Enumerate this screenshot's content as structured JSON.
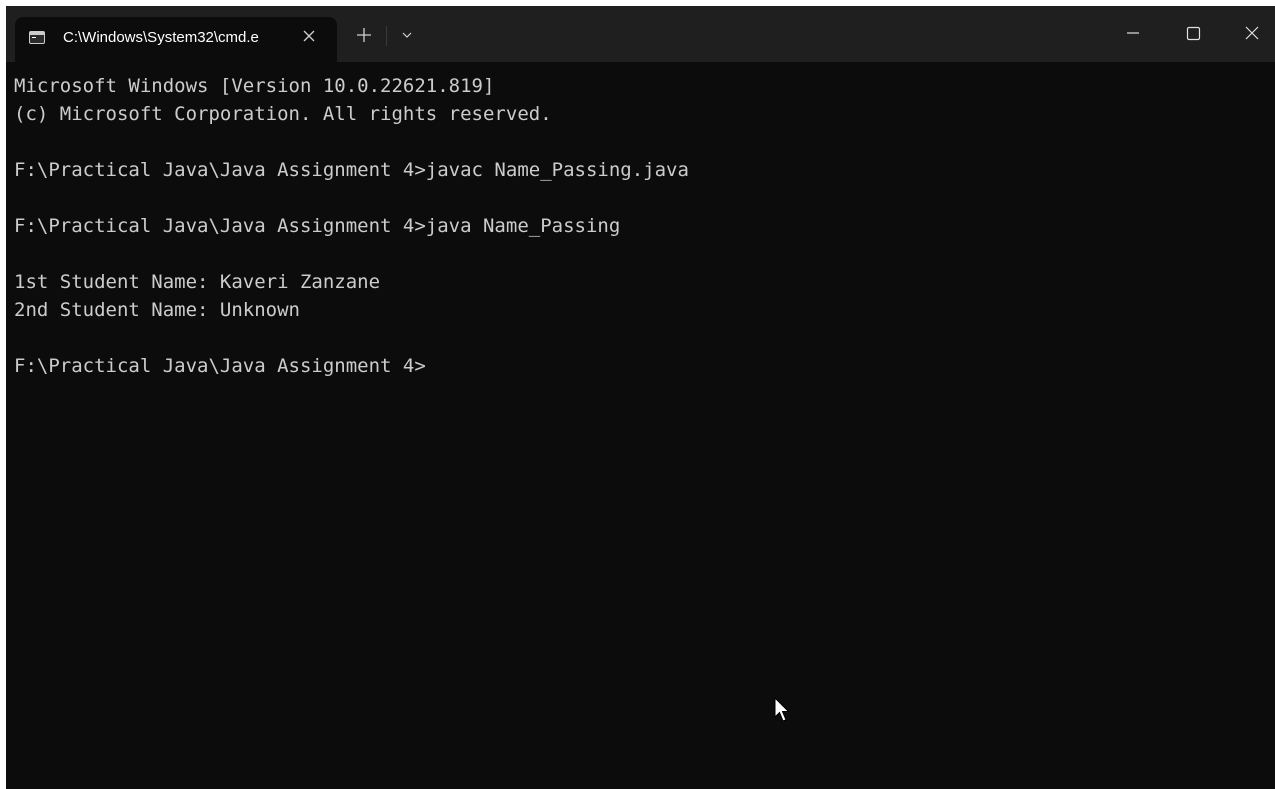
{
  "tab": {
    "title": "C:\\Windows\\System32\\cmd.e",
    "icon": "terminal-icon"
  },
  "titlebar": {
    "new_tab_icon": "plus-icon",
    "dropdown_icon": "chevron-down-icon",
    "minimize_icon": "minimize-icon",
    "maximize_icon": "maximize-icon",
    "close_icon": "close-icon"
  },
  "console": {
    "lines": [
      "Microsoft Windows [Version 10.0.22621.819]",
      "(c) Microsoft Corporation. All rights reserved.",
      "",
      "F:\\Practical Java\\Java Assignment 4>javac Name_Passing.java",
      "",
      "F:\\Practical Java\\Java Assignment 4>java Name_Passing",
      "",
      "1st Student Name: Kaveri Zanzane",
      "2nd Student Name: Unknown",
      "",
      "F:\\Practical Java\\Java Assignment 4>"
    ]
  },
  "colors": {
    "console_bg": "#0c0c0c",
    "titlebar_bg": "#1f1f1f",
    "text": "#cccccc"
  }
}
